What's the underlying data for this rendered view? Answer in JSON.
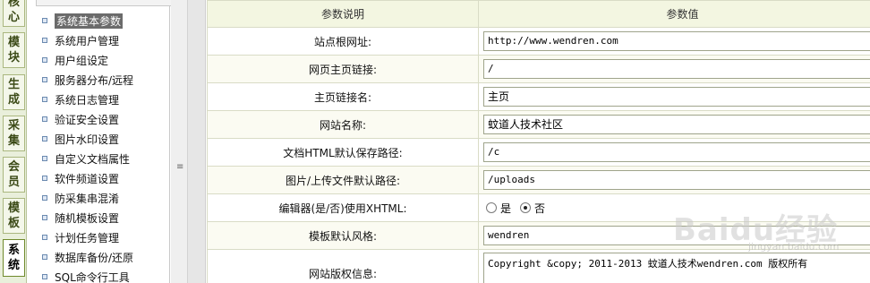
{
  "tabs": [
    {
      "label": "核心",
      "active": false
    },
    {
      "label": "模块",
      "active": false
    },
    {
      "label": "生成",
      "active": false
    },
    {
      "label": "采集",
      "active": false
    },
    {
      "label": "会员",
      "active": false
    },
    {
      "label": "模板",
      "active": false
    },
    {
      "label": "系统",
      "active": true
    }
  ],
  "menu": {
    "items": [
      {
        "label": "系统基本参数",
        "active": true
      },
      {
        "label": "系统用户管理"
      },
      {
        "label": "用户组设定"
      },
      {
        "label": "服务器分布/远程"
      },
      {
        "label": "系统日志管理"
      },
      {
        "label": "验证安全设置"
      },
      {
        "label": "图片水印设置"
      },
      {
        "label": "自定义文档属性"
      },
      {
        "label": "软件频道设置"
      },
      {
        "label": "防采集串混淆"
      },
      {
        "label": "随机模板设置"
      },
      {
        "label": "计划任务管理"
      },
      {
        "label": "数据库备份/还原"
      },
      {
        "label": "SQL命令行工具"
      }
    ]
  },
  "table": {
    "headers": [
      "参数说明",
      "参数值"
    ],
    "rows": [
      {
        "label": "站点根网址:",
        "value": "http://www.wendren.com"
      },
      {
        "label": "网页主页链接:",
        "value": "/"
      },
      {
        "label": "主页链接名:",
        "value": "主页"
      },
      {
        "label": "网站名称:",
        "value": "蚊道人技术社区"
      },
      {
        "label": "文档HTML默认保存路径:",
        "value": "/c"
      },
      {
        "label": "图片/上传文件默认路径:",
        "value": "/uploads"
      },
      {
        "label": "编辑器(是/否)使用XHTML:",
        "options": [
          "是",
          "否"
        ],
        "selected": "否"
      },
      {
        "label": "模板默认风格:",
        "value": "wendren"
      },
      {
        "label": "网站版权信息:",
        "value": "Copyright &copy; 2011-2013 蚊道人技术wendren.com 版权所有"
      }
    ]
  },
  "watermark": {
    "text": "Baidu经验",
    "sub": "jingyan.baidu.com"
  },
  "colors": {
    "tab_bg": "#e9efdb",
    "header_bg": "#f3f6e1",
    "active_menu_bg": "#6b6b6b"
  }
}
